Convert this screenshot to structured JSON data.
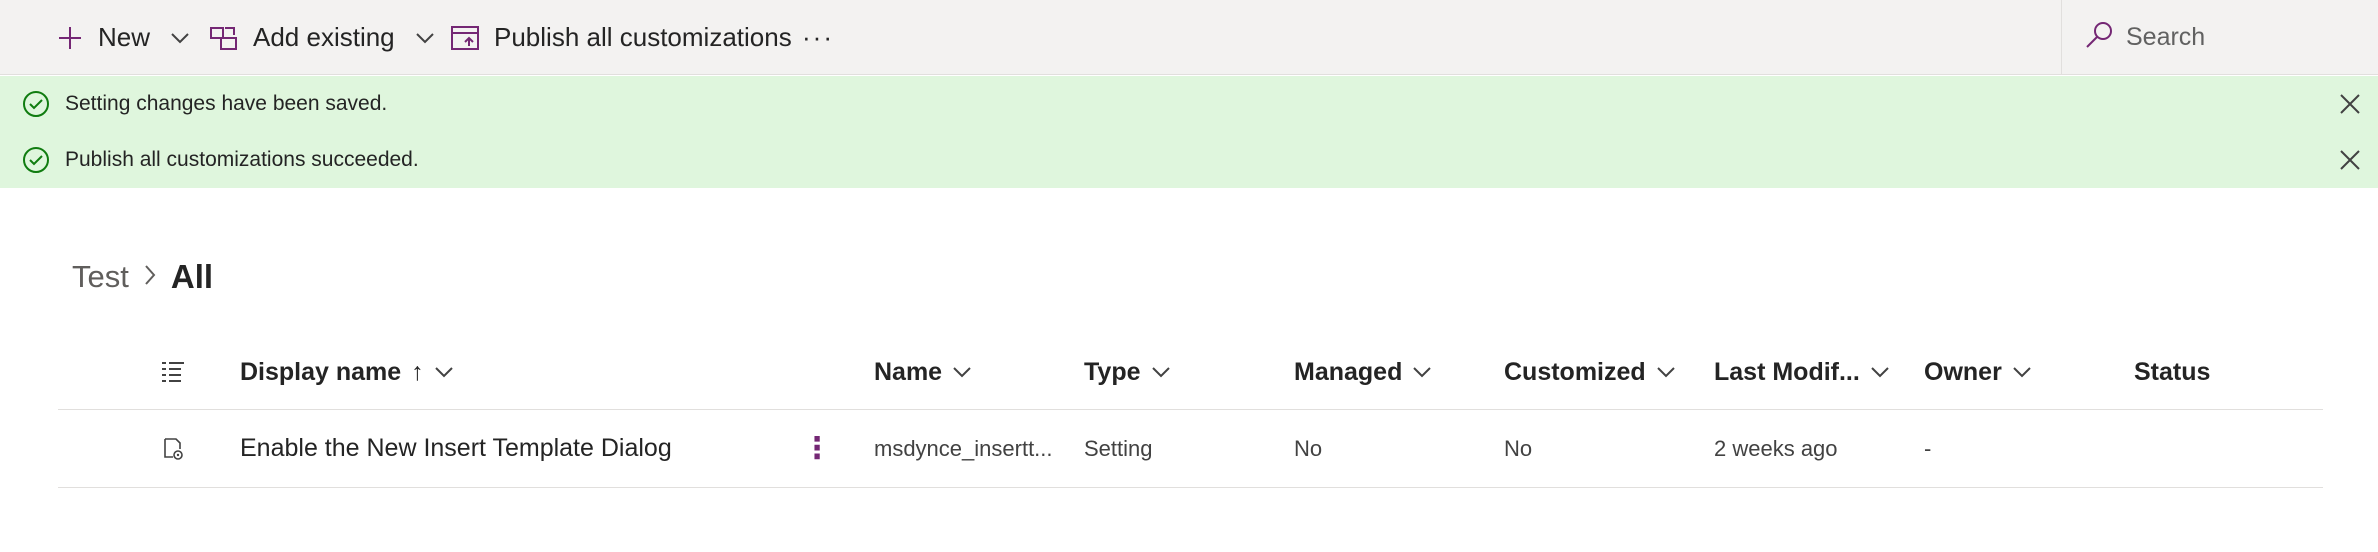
{
  "toolbar": {
    "new_label": "New",
    "add_existing_label": "Add existing",
    "publish_label": "Publish all customizations",
    "more_label": "···",
    "search_placeholder": "Search"
  },
  "notifications": [
    {
      "text": "Setting changes have been saved."
    },
    {
      "text": "Publish all customizations succeeded."
    }
  ],
  "breadcrumb": {
    "parent": "Test",
    "current": "All"
  },
  "table": {
    "headers": {
      "display_name": "Display name",
      "sort_arrow": "↑",
      "name": "Name",
      "type": "Type",
      "managed": "Managed",
      "customized": "Customized",
      "last_modified": "Last Modif...",
      "owner": "Owner",
      "status": "Status"
    },
    "rows": [
      {
        "display_name": "Enable the New Insert Template Dialog",
        "more": "⋮",
        "name": "msdynce_insertt...",
        "type": "Setting",
        "managed": "No",
        "customized": "No",
        "last_modified": "2 weeks ago",
        "owner": "-",
        "status": ""
      }
    ]
  },
  "colors": {
    "accent": "#742774",
    "success_bg": "#dff6dd",
    "success_icon": "#107c10",
    "toolbar_bg": "#f3f2f1"
  }
}
